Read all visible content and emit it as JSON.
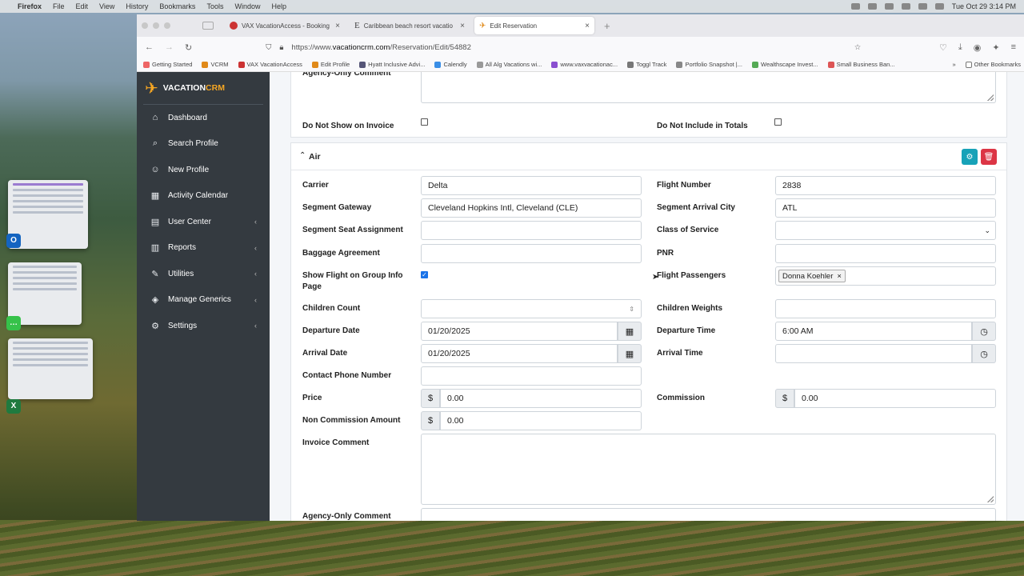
{
  "menubar": {
    "app": "Firefox",
    "items": [
      "File",
      "Edit",
      "View",
      "History",
      "Bookmarks",
      "Tools",
      "Window",
      "Help"
    ],
    "clock": "Tue Oct 29  3:14 PM"
  },
  "tabs": [
    {
      "title": "VAX VacationAccess - Booking",
      "active": false
    },
    {
      "title": "Caribbean beach resort vacatio",
      "active": false
    },
    {
      "title": "Edit Reservation",
      "active": true
    }
  ],
  "url": {
    "prefix": "https://www.",
    "host": "vacationcrm.com",
    "path": "/Reservation/Edit/54882"
  },
  "bookmarks": [
    "Getting Started",
    "VCRM",
    "VAX VacationAccess",
    "Edit Profile",
    "Hyatt Inclusive Advi...",
    "Calendly",
    "All Alg Vacations wi...",
    "www.vaxvacationac...",
    "Toggl Track",
    "Portfolio Snapshot |...",
    "Wealthscape Invest...",
    "Small Business Ban...",
    "Other Bookmarks"
  ],
  "brand": {
    "name_a": "VACATION",
    "name_b": "CRM"
  },
  "sidebar": {
    "items": [
      {
        "label": "Dashboard",
        "icon": "home-icon",
        "glyph": "⌂"
      },
      {
        "label": "Search Profile",
        "icon": "search-icon",
        "glyph": "⌕"
      },
      {
        "label": "New Profile",
        "icon": "user-plus-icon",
        "glyph": "☺"
      },
      {
        "label": "Activity Calendar",
        "icon": "calendar-icon",
        "glyph": "▦"
      },
      {
        "label": "User Center",
        "icon": "server-icon",
        "glyph": "▤"
      },
      {
        "label": "Reports",
        "icon": "report-icon",
        "glyph": "▥"
      },
      {
        "label": "Utilities",
        "icon": "tools-icon",
        "glyph": "✎"
      },
      {
        "label": "Manage Generics",
        "icon": "layers-icon",
        "glyph": "◈"
      },
      {
        "label": "Settings",
        "icon": "gear-icon",
        "glyph": "⚙"
      }
    ]
  },
  "top_card": {
    "agency_comment_label": "Agency-Only Comment",
    "do_not_show_invoice": "Do Not Show on Invoice",
    "do_not_include_totals": "Do Not Include in Totals"
  },
  "air": {
    "header": "Air",
    "carrier_label": "Carrier",
    "carrier": "Delta",
    "flight_number_label": "Flight Number",
    "flight_number": "2838",
    "gateway_label": "Segment Gateway",
    "gateway": "Cleveland Hopkins Intl, Cleveland (CLE)",
    "arrival_city_label": "Segment Arrival City",
    "arrival_city": "ATL",
    "seat_label": "Segment Seat Assignment",
    "seat": "",
    "class_label": "Class of Service",
    "class_value": "",
    "baggage_label": "Baggage Agreement",
    "baggage": "",
    "pnr_label": "PNR",
    "pnr": "",
    "show_flight_label": "Show Flight on Group Info Page",
    "show_flight_checked": true,
    "passengers_label": "Flight Passengers",
    "passenger": "Donna Koehler",
    "children_count_label": "Children Count",
    "children_count": "",
    "children_weights_label": "Children Weights",
    "children_weights": "",
    "departure_date_label": "Departure Date",
    "departure_date": "01/20/2025",
    "departure_time_label": "Departure Time",
    "departure_time": "6:00 AM",
    "arrival_date_label": "Arrival Date",
    "arrival_date": "01/20/2025",
    "arrival_time_label": "Arrival Time",
    "arrival_time": "",
    "contact_phone_label": "Contact Phone Number",
    "contact_phone": "",
    "price_label": "Price",
    "price": "0.00",
    "commission_label": "Commission",
    "commission": "0.00",
    "non_commission_label": "Non Commission Amount",
    "non_commission": "0.00",
    "currency": "$",
    "invoice_comment_label": "Invoice Comment",
    "agency_comment_label": "Agency-Only Comment"
  }
}
